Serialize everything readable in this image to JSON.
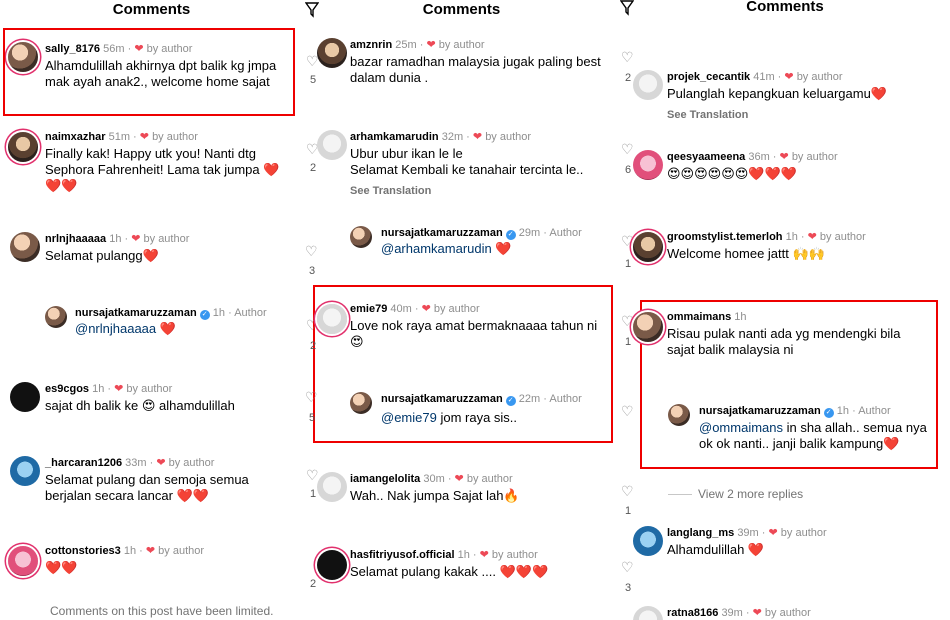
{
  "title": "Comments",
  "heart_glyph": "❤",
  "panel1": {
    "comments": [
      {
        "user": "sally_8176",
        "time": "56m",
        "by_author": "by author",
        "text": "Alhamdulillah akhirnya dpt balik kg jmpa mak ayah anak2., welcome home sajat"
      },
      {
        "user": "naimxazhar",
        "time": "51m",
        "by_author": "by author",
        "text": "Finally kak! Happy utk you! Nanti dtg Sephora Fahrenheit! Lama tak jumpa ❤️❤️❤️"
      },
      {
        "user": "nrlnjhaaaaa",
        "time": "1h",
        "by_author": "by author",
        "text": "Selamat pulangg❤️"
      },
      {
        "user": "es9cgos",
        "time": "1h",
        "by_author": "by author",
        "text": "sajat dh balik ke 😍 alhamdulillah"
      },
      {
        "user": "_harcaran1206",
        "time": "33m",
        "by_author": "by author",
        "text": "Selamat pulang dan semoja semua berjalan secara lancar ❤️❤️"
      },
      {
        "user": "cottonstories3",
        "time": "1h",
        "by_author": "by author",
        "text": "❤️❤️"
      }
    ],
    "reply": {
      "user": "nursajatkamaruzzaman",
      "time": "1h",
      "role": "Author",
      "mention": "@nrlnjhaaaaa",
      "text": " ❤️"
    },
    "limited": "Comments on this post have been limited."
  },
  "panel2": {
    "comments": [
      {
        "user": "amznrin",
        "time": "25m",
        "by_author": "by author",
        "text": "bazar ramadhan malaysia jugak paling best dalam dunia .",
        "likes": "5"
      },
      {
        "user": "arhamkamarudin",
        "time": "32m",
        "by_author": "by author",
        "text": "Ubur ubur ikan le le\nSelamat Kembali ke tanahair tercinta le..",
        "likes": "2",
        "see_translation": "See Translation"
      },
      {
        "user": "emie79",
        "time": "40m",
        "by_author": "by author",
        "text": "Love nok raya amat bermaknaaaa tahun ni 😍",
        "likes": "2"
      },
      {
        "user": "iamangelolita",
        "time": "30m",
        "by_author": "by author",
        "text": "Wah.. Nak jumpa Sajat lah🔥",
        "likes": "1"
      },
      {
        "user": "hasfitriyusof.official",
        "time": "1h",
        "by_author": "by author",
        "text": "Selamat pulang kakak .... ❤️❤️❤️",
        "likes": "2"
      }
    ],
    "reply1": {
      "user": "nursajatkamaruzzaman",
      "time": "29m",
      "role": "Author",
      "mention": "@arhamkamarudin",
      "text": " ❤️",
      "likes": "3"
    },
    "reply2": {
      "user": "nursajatkamaruzzaman",
      "time": "22m",
      "role": "Author",
      "mention": "@emie79",
      "text": " jom raya sis..",
      "likes": "5"
    }
  },
  "panel3": {
    "comments": [
      {
        "user": "projek_cecantik",
        "time": "41m",
        "by_author": "by author",
        "text": "Pulanglah kepangkuan keluargamu❤️",
        "likes": "2",
        "see_translation": "See Translation"
      },
      {
        "user": "qeesyaameena",
        "time": "36m",
        "by_author": "by author",
        "text": "😍😍😍😍😍😍❤️❤️❤️",
        "likes": "6"
      },
      {
        "user": "groomstylist.temerloh",
        "time": "1h",
        "by_author": "by author",
        "text": "Welcome homee jattt 🙌🙌",
        "likes": "1"
      },
      {
        "user": "ommaimans",
        "time": "1h",
        "text": "Risau pulak nanti ada yg mendengki bila sajat balik malaysia ni",
        "likes": "1"
      },
      {
        "user": "langlang_ms",
        "time": "39m",
        "by_author": "by author",
        "text": "Alhamdulillah ❤️",
        "likes": "3"
      },
      {
        "user": "ratna8166",
        "time": "39m",
        "by_author": "by author"
      }
    ],
    "reply": {
      "user": "nursajatkamaruzzaman",
      "time": "1h",
      "role": "Author",
      "mention": "@ommaimans",
      "text": " in sha allah.. semua nya ok ok nanti.. janji balik kampung❤️",
      "likes": "1"
    },
    "view_more": "View 2 more replies"
  },
  "colors": {
    "highlight": "#e00000",
    "heart": "#ed4956",
    "verified": "#3897f0",
    "mention": "#00376b"
  }
}
